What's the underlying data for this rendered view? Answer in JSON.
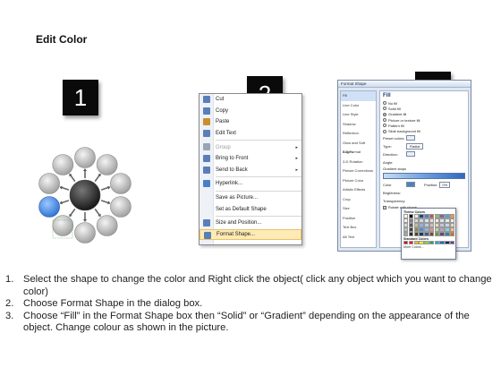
{
  "title": "Edit Color",
  "step_badges": [
    "1",
    "2",
    "3"
  ],
  "colors": {
    "badge_bg": "#0a0a0a",
    "center_node": "#3a3a3a",
    "outer_node": "#b8b8b8",
    "selected_node": "#4a8fe0",
    "menu_highlight": "#fdeab5"
  },
  "context_menu": {
    "items": [
      {
        "label": "Cut",
        "icon": "scissors-icon",
        "arrow": ""
      },
      {
        "label": "Copy",
        "icon": "copy-icon",
        "arrow": ""
      },
      {
        "label": "Paste",
        "icon": "paste-icon",
        "arrow": ""
      },
      {
        "label": "Edit Text",
        "icon": "edit-text-icon",
        "arrow": ""
      },
      {
        "label": "Group",
        "icon": "group-icon",
        "arrow": "▸"
      },
      {
        "label": "Bring to Front",
        "icon": "bring-to-front-icon",
        "arrow": "▸"
      },
      {
        "label": "Send to Back",
        "icon": "send-to-back-icon",
        "arrow": "▸"
      },
      {
        "label": "Hyperlink...",
        "icon": "hyperlink-icon",
        "arrow": ""
      },
      {
        "label": "Save as Picture...",
        "icon": "",
        "arrow": ""
      },
      {
        "label": "Set as Default Shape",
        "icon": "",
        "arrow": ""
      },
      {
        "label": "Size and Position...",
        "icon": "size-position-icon",
        "arrow": ""
      },
      {
        "label": "Format Shape...",
        "icon": "format-shape-icon",
        "arrow": ""
      }
    ]
  },
  "format_dialog": {
    "title": "Format Shape",
    "categories": [
      "Fill",
      "Line Color",
      "Line Style",
      "Shadow",
      "Reflection",
      "Glow and Soft Edges",
      "3-D Format",
      "3-D Rotation",
      "Picture Corrections",
      "Picture Color",
      "Artistic Effects",
      "Crop",
      "Size",
      "Position",
      "Text Box",
      "Alt Text"
    ],
    "panel_heading": "Fill",
    "fill_options": [
      "No fill",
      "Solid fill",
      "Gradient fill",
      "Picture or texture fill",
      "Pattern fill",
      "Slide background fill"
    ],
    "fields": [
      "Preset colors:",
      "Type:",
      "Direction:",
      "Angle:",
      "Gradient stops"
    ],
    "type_value": "Radial",
    "color_label": "Color",
    "position_label": "Position:",
    "position_value": "0%",
    "brightness_label": "Brightness:",
    "transparency_label": "Transparency:",
    "rotate_label": "Rotate with shape"
  },
  "color_picker": {
    "theme_label": "Theme Colors",
    "standard_label": "Standard Colors",
    "more_label": "More Colors...",
    "theme_colors": [
      "#ffffff",
      "#000000",
      "#eeece1",
      "#1f497d",
      "#4f81bd",
      "#c0504d",
      "#9bbb59",
      "#8064a2",
      "#4bacc6",
      "#f79646",
      "#f2f2f2",
      "#7f7f7f",
      "#ddd9c3",
      "#c6d9f0",
      "#dbe5f1",
      "#f2dcdb",
      "#ebf1dd",
      "#e5e0ec",
      "#dbeef3",
      "#fdeada",
      "#d8d8d8",
      "#595959",
      "#c4bd97",
      "#8db3e2",
      "#b8cce4",
      "#e5b9b7",
      "#d7e3bc",
      "#ccc1d9",
      "#b7dde8",
      "#fbd5b5",
      "#bfbfbf",
      "#3f3f3f",
      "#938953",
      "#548dd4",
      "#95b3d7",
      "#d99694",
      "#c3d69b",
      "#b2a2c7",
      "#92cddc",
      "#fac08f",
      "#a5a5a5",
      "#262626",
      "#494429",
      "#17365d",
      "#366092",
      "#953734",
      "#76923c",
      "#5f497a",
      "#31859b",
      "#e36c09"
    ],
    "standard_colors": [
      "#c00000",
      "#ff0000",
      "#ffc000",
      "#ffff00",
      "#92d050",
      "#00b050",
      "#00b0f0",
      "#0070c0",
      "#002060",
      "#7030a0"
    ]
  },
  "instructions": [
    {
      "num": "1.",
      "text": "Select the shape to change the color and Right click the object( click any object which you want to change color)"
    },
    {
      "num": "2.",
      "text": "Choose Format Shape in the dialog box."
    },
    {
      "num": "3.",
      "text": "Choose “Fill” in the Format Shape box then “Solid” or “Gradient” depending on the appearance of the object. Change colour as shown in the picture."
    }
  ]
}
